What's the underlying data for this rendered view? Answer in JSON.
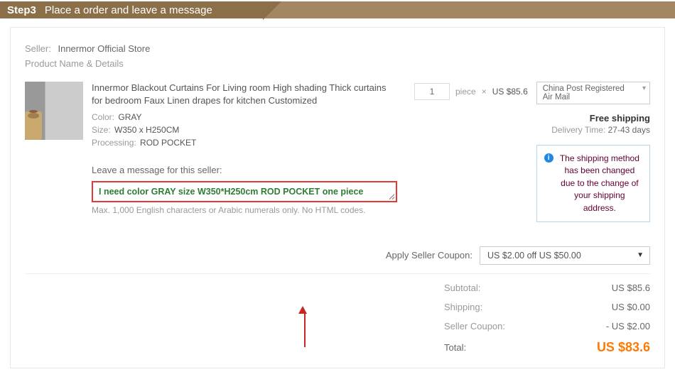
{
  "header": {
    "step_num": "Step3",
    "step_title": "Place a order and leave a message"
  },
  "seller": {
    "label": "Seller:",
    "name": "Innermor Official Store",
    "details_label": "Product Name & Details"
  },
  "product": {
    "title": "Innermor Blackout Curtains For Living room High shading Thick curtains for bedroom Faux Linen drapes for kitchen Customized",
    "color_label": "Color:",
    "color_value": "GRAY",
    "size_label": "Size:",
    "size_value": "W350 x H250CM",
    "proc_label": "Processing:",
    "proc_value": "ROD POCKET"
  },
  "qty": {
    "value": "1",
    "unit": "piece",
    "times": "×",
    "price": "US $85.6"
  },
  "shipping": {
    "method": "China Post Registered Air Mail",
    "free_label": "Free shipping",
    "delivery_label": "Delivery Time:",
    "delivery_value": "27-43 days",
    "notice": "The shipping method has been changed due to the change of your shipping address."
  },
  "message": {
    "label": "Leave a message for this seller:",
    "value": "I need color GRAY size W350*H250cm ROD POCKET one piece",
    "hint": "Max. 1,000 English characters or Arabic numerals only. No HTML codes."
  },
  "coupon": {
    "label": "Apply Seller Coupon:",
    "selected": "US $2.00 off US $50.00"
  },
  "summary": {
    "subtotal_k": "Subtotal:",
    "subtotal_v": "US $85.6",
    "shipping_k": "Shipping:",
    "shipping_v": "US $0.00",
    "coupon_k": "Seller Coupon:",
    "coupon_v": "- US $2.00",
    "total_k": "Total:",
    "total_v": "US $83.6"
  }
}
